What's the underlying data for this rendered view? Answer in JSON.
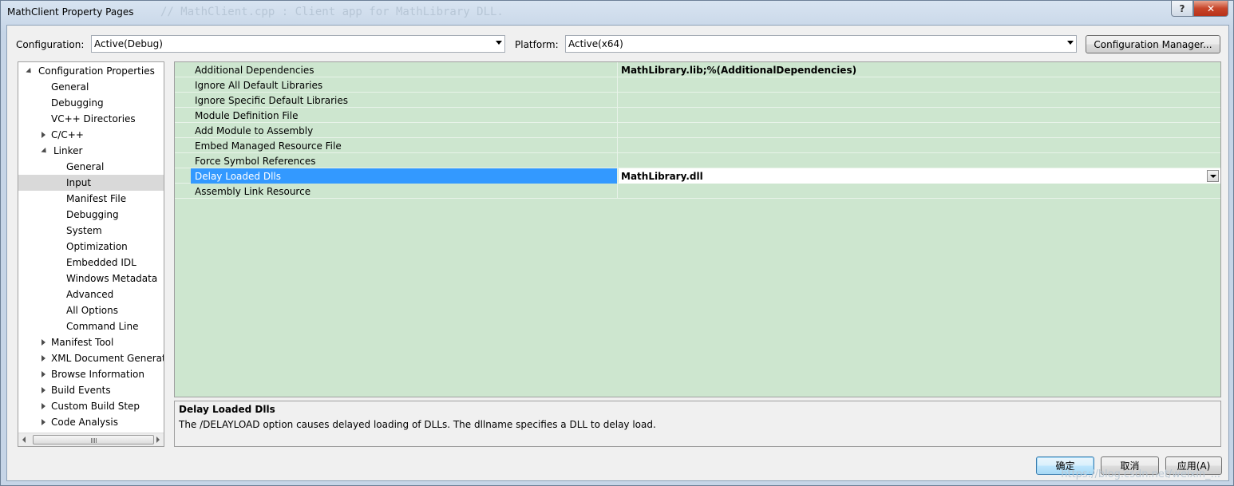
{
  "window": {
    "title": "MathClient Property Pages",
    "background_code": "// MathClient.cpp : Client app for MathLibrary DLL.",
    "help_label": "?",
    "close_label": "✕"
  },
  "toolbar": {
    "configuration_label": "Configuration:",
    "configuration_value": "Active(Debug)",
    "platform_label": "Platform:",
    "platform_value": "Active(x64)",
    "config_manager_label": "Configuration Manager..."
  },
  "tree": {
    "items": [
      {
        "label": "Configuration Properties",
        "expander": "expanded",
        "level": 0
      },
      {
        "label": "General",
        "expander": "none",
        "level": 1
      },
      {
        "label": "Debugging",
        "expander": "none",
        "level": 1
      },
      {
        "label": "VC++ Directories",
        "expander": "none",
        "level": 1
      },
      {
        "label": "C/C++",
        "expander": "collapsed",
        "level": 1
      },
      {
        "label": "Linker",
        "expander": "expanded",
        "level": 1
      },
      {
        "label": "General",
        "expander": "none",
        "level": 2
      },
      {
        "label": "Input",
        "expander": "none",
        "level": 2,
        "selected": true
      },
      {
        "label": "Manifest File",
        "expander": "none",
        "level": 2
      },
      {
        "label": "Debugging",
        "expander": "none",
        "level": 2
      },
      {
        "label": "System",
        "expander": "none",
        "level": 2
      },
      {
        "label": "Optimization",
        "expander": "none",
        "level": 2
      },
      {
        "label": "Embedded IDL",
        "expander": "none",
        "level": 2
      },
      {
        "label": "Windows Metadata",
        "expander": "none",
        "level": 2
      },
      {
        "label": "Advanced",
        "expander": "none",
        "level": 2
      },
      {
        "label": "All Options",
        "expander": "none",
        "level": 2
      },
      {
        "label": "Command Line",
        "expander": "none",
        "level": 2
      },
      {
        "label": "Manifest Tool",
        "expander": "collapsed",
        "level": 1
      },
      {
        "label": "XML Document Generat",
        "expander": "collapsed",
        "level": 1
      },
      {
        "label": "Browse Information",
        "expander": "collapsed",
        "level": 1
      },
      {
        "label": "Build Events",
        "expander": "collapsed",
        "level": 1
      },
      {
        "label": "Custom Build Step",
        "expander": "collapsed",
        "level": 1
      },
      {
        "label": "Code Analysis",
        "expander": "collapsed",
        "level": 1
      }
    ]
  },
  "grid": {
    "rows": [
      {
        "name": "Additional Dependencies",
        "value": "MathLibrary.lib;%(AdditionalDependencies)"
      },
      {
        "name": "Ignore All Default Libraries",
        "value": ""
      },
      {
        "name": "Ignore Specific Default Libraries",
        "value": ""
      },
      {
        "name": "Module Definition File",
        "value": ""
      },
      {
        "name": "Add Module to Assembly",
        "value": ""
      },
      {
        "name": "Embed Managed Resource File",
        "value": ""
      },
      {
        "name": "Force Symbol References",
        "value": ""
      },
      {
        "name": "Delay Loaded Dlls",
        "value": "MathLibrary.dll",
        "selected": true
      },
      {
        "name": "Assembly Link Resource",
        "value": ""
      }
    ]
  },
  "description": {
    "title": "Delay Loaded Dlls",
    "text": "The /DELAYLOAD option causes delayed loading of DLLs. The dllname specifies a DLL to delay load."
  },
  "buttons": {
    "ok": "确定",
    "cancel": "取消",
    "apply": "应用(A)"
  },
  "watermark": "https://blog.csdn.net/weixin_..."
}
